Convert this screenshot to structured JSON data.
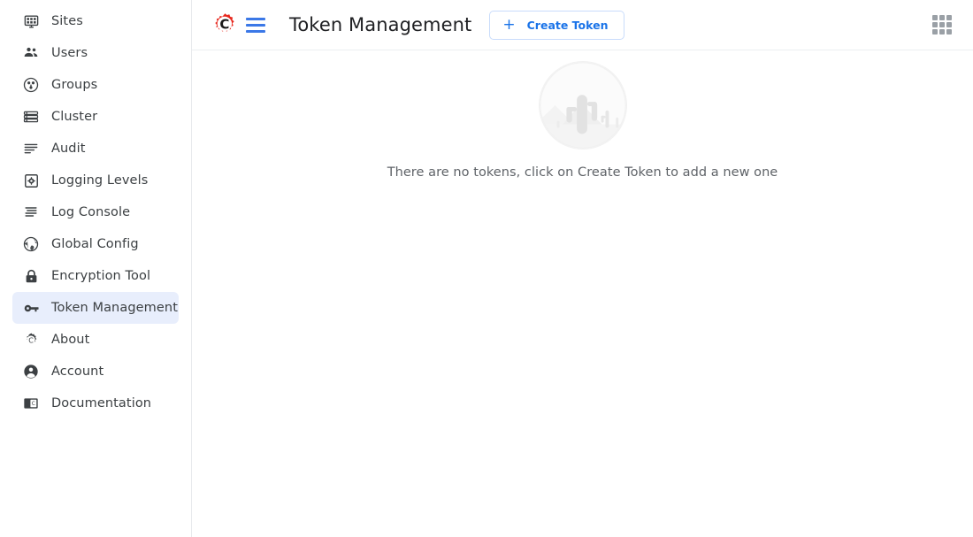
{
  "sidebar": {
    "items": [
      {
        "label": "Sites",
        "icon": "sites-icon",
        "active": false
      },
      {
        "label": "Users",
        "icon": "users-icon",
        "active": false
      },
      {
        "label": "Groups",
        "icon": "groups-icon",
        "active": false
      },
      {
        "label": "Cluster",
        "icon": "cluster-icon",
        "active": false
      },
      {
        "label": "Audit",
        "icon": "audit-icon",
        "active": false
      },
      {
        "label": "Logging Levels",
        "icon": "logging-levels-icon",
        "active": false
      },
      {
        "label": "Log Console",
        "icon": "log-console-icon",
        "active": false
      },
      {
        "label": "Global Config",
        "icon": "global-config-icon",
        "active": false
      },
      {
        "label": "Encryption Tool",
        "icon": "encryption-tool-icon",
        "active": false
      },
      {
        "label": "Token Management",
        "icon": "token-management-icon",
        "active": true
      },
      {
        "label": "About",
        "icon": "about-icon",
        "active": false
      },
      {
        "label": "Account",
        "icon": "account-icon",
        "active": false
      },
      {
        "label": "Documentation",
        "icon": "documentation-icon",
        "active": false
      }
    ],
    "active_item": "Token Management",
    "active_background": "#e8eefc",
    "text_color": "#3c4043"
  },
  "topbar": {
    "logo_icon": "gear-c-logo-icon",
    "logo_color": "#e8281e",
    "menu_icon": "hamburger-menu-icon",
    "menu_color": "#3b78e7",
    "title": "Token Management",
    "create_button": {
      "label": "Create Token",
      "plus_glyph": "+",
      "text_color": "#1a73e8",
      "border_color": "#c9dcfb"
    },
    "apps_icon": "apps-grid-icon",
    "apps_icon_color": "#9aa0a6"
  },
  "content": {
    "empty_state": {
      "illustration_icon": "empty-desert-cactus-illustration",
      "message": "There are no tokens, click on Create Token to add a new one",
      "message_color": "#5f6368"
    }
  }
}
